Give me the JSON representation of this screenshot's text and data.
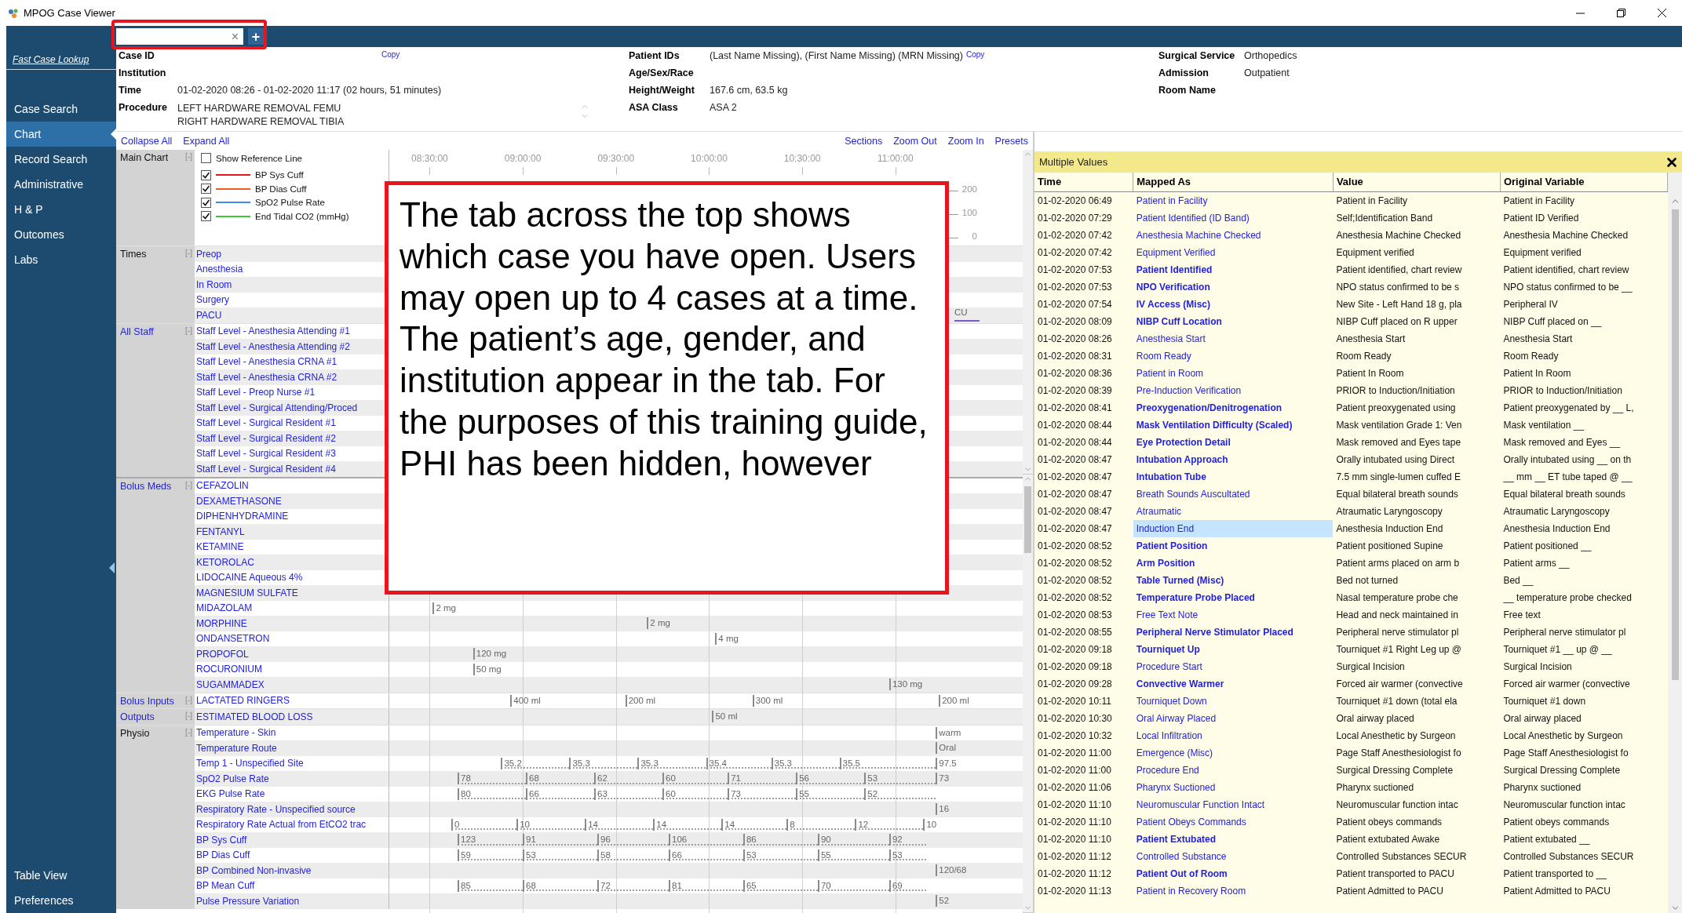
{
  "window": {
    "title": "MPOG Case Viewer"
  },
  "tab_bar": {
    "close_glyph": "×",
    "add_glyph": "+"
  },
  "sidebar": {
    "lookup": "Fast Case Lookup",
    "items": [
      {
        "label": "Case Search",
        "selected": false
      },
      {
        "label": "Chart",
        "selected": true
      },
      {
        "label": "Record Search",
        "selected": false
      },
      {
        "label": "Administrative",
        "selected": false
      },
      {
        "label": "H & P",
        "selected": false
      },
      {
        "label": "Outcomes",
        "selected": false
      },
      {
        "label": "Labs",
        "selected": false
      }
    ],
    "bottom_items": [
      {
        "label": "Table View",
        "selected": false
      },
      {
        "label": "Preferences",
        "selected": false
      }
    ]
  },
  "case_header": {
    "columns": [
      [
        {
          "label": "Case ID",
          "copy": "Copy"
        },
        {
          "label": "Institution"
        },
        {
          "label": "Time",
          "value": "01-02-2020 08:26 - 01-02-2020 11:17 (02 hours, 51 minutes)"
        },
        {
          "label": "Procedure",
          "lines": [
            "LEFT HARDWARE REMOVAL FEMU",
            "RIGHT HARDWARE REMOVAL TIBIA"
          ]
        }
      ],
      [
        {
          "label": "Patient IDs",
          "value": "(Last Name Missing), (First Name Missing) (MRN Missing)",
          "copy": "Copy"
        },
        {
          "label": "Age/Sex/Race"
        },
        {
          "label": "Height/Weight",
          "value": "167.6 cm, 63.5 kg"
        },
        {
          "label": "ASA Class",
          "value": "ASA 2"
        }
      ],
      [
        {
          "label": "Surgical Service",
          "value": "Orthopedics"
        },
        {
          "label": "Admission",
          "value": "Outpatient"
        },
        {
          "label": "Room Name"
        }
      ]
    ]
  },
  "chart": {
    "links_left": [
      "Collapse All",
      "Expand All"
    ],
    "links_right": [
      "Sections",
      "Zoom Out",
      "Zoom In",
      "Presets"
    ],
    "axis": [
      "08:30:00",
      "09:00:00",
      "09:30:00",
      "10:00:00",
      "10:30:00",
      "11:00:00"
    ],
    "main_chart": {
      "label": "Main Chart",
      "toggle": "[-]",
      "reference": {
        "label": "Show Reference Line",
        "checked": false
      },
      "series": [
        {
          "name": "BP Sys Cuff",
          "checked": true,
          "color": "#e8141e"
        },
        {
          "name": "BP Dias Cuff",
          "checked": true,
          "color": "#f05a1e"
        },
        {
          "name": "SpO2 Pulse Rate",
          "checked": true,
          "color": "#3c8cf0"
        },
        {
          "name": "End Tidal CO2 (mmHg)",
          "checked": true,
          "color": "#3cc83c"
        }
      ],
      "scale": [
        "200",
        "100",
        "0"
      ]
    },
    "groups": [
      {
        "label": "Times",
        "link": false,
        "toggle": "[-]",
        "rows": [
          {
            "label": "Preop"
          },
          {
            "label": "Anesthesia"
          },
          {
            "label": "In Room"
          },
          {
            "label": "Surgery"
          },
          {
            "label": "PACU",
            "markers": [
              {
                "kind": "span",
                "text": "CU"
              }
            ]
          }
        ]
      },
      {
        "label": "All Staff",
        "link": true,
        "toggle": "[-]",
        "rows": [
          {
            "label": "Staff Level - Anesthesia Attending #1"
          },
          {
            "label": "Staff Level - Anesthesia Attending #2"
          },
          {
            "label": "Staff Level - Anesthesia CRNA #1"
          },
          {
            "label": "Staff Level - Anesthesia CRNA #2"
          },
          {
            "label": "Staff Level - Preop Nurse #1"
          },
          {
            "label": "Staff Level - Surgical Attending/Proced"
          },
          {
            "label": "Staff Level - Surgical Resident #1"
          },
          {
            "label": "Staff Level - Surgical Resident #2"
          },
          {
            "label": "Staff Level - Surgical Resident #3"
          },
          {
            "label": "Staff Level - Surgical Resident #4"
          }
        ]
      },
      {
        "label": "Bolus Meds",
        "link": true,
        "toggle": "[-]",
        "rows": [
          {
            "label": "CEFAZOLIN"
          },
          {
            "label": "DEXAMETHASONE"
          },
          {
            "label": "DIPHENHYDRAMINE"
          },
          {
            "label": "FENTANYL"
          },
          {
            "label": "KETAMINE"
          },
          {
            "label": "KETOROLAC"
          },
          {
            "label": "LIDOCAINE Aqueous 4%"
          },
          {
            "label": "MAGNESIUM SULFATE"
          },
          {
            "label": "MIDAZOLAM",
            "markers": [
              {
                "kind": "tick",
                "text": "2 mg",
                "dotted": false
              }
            ]
          },
          {
            "label": "MORPHINE",
            "markers": [
              {
                "kind": "tick",
                "text": "2 mg",
                "dotted": false
              }
            ]
          },
          {
            "label": "ONDANSETRON",
            "markers": [
              {
                "kind": "tick",
                "text": "4 mg",
                "dotted": false
              }
            ]
          },
          {
            "label": "PROPOFOL",
            "markers": [
              {
                "kind": "tick",
                "text": "120 mg",
                "dotted": false
              }
            ]
          },
          {
            "label": "ROCURONIUM",
            "markers": [
              {
                "kind": "tick",
                "text": "50 mg",
                "dotted": false
              }
            ]
          },
          {
            "label": "SUGAMMADEX",
            "markers": [
              {
                "kind": "tick",
                "text": "130 mg",
                "dotted": false
              }
            ]
          }
        ]
      },
      {
        "label": "Bolus Inputs",
        "link": true,
        "toggle": "[-]",
        "rows": [
          {
            "label": "LACTATED RINGERS",
            "markers": [
              {
                "kind": "tick",
                "text": "400 ml",
                "dotted": false
              },
              {
                "kind": "tick",
                "text": "200 ml",
                "dotted": false
              },
              {
                "kind": "tick",
                "text": "300 ml",
                "dotted": false
              },
              {
                "kind": "tick",
                "text": "200 ml",
                "dotted": false
              }
            ]
          }
        ]
      },
      {
        "label": "Outputs",
        "link": true,
        "toggle": "[-]",
        "rows": [
          {
            "label": "ESTIMATED BLOOD LOSS",
            "markers": [
              {
                "kind": "tick",
                "text": "50 ml",
                "dotted": false
              }
            ]
          }
        ]
      },
      {
        "label": "Physio",
        "link": false,
        "toggle": "[-]",
        "rows": [
          {
            "label": "Temperature - Skin",
            "markers": [
              {
                "kind": "tick",
                "text": "warm",
                "dotted": false
              }
            ]
          },
          {
            "label": "Temperature Route",
            "markers": [
              {
                "kind": "tick",
                "text": "Oral",
                "dotted": false
              }
            ]
          },
          {
            "label": "Temp 1 - Unspecified Site",
            "markers": [
              {
                "kind": "tick",
                "text": "35.2",
                "dotted": true
              },
              {
                "kind": "tick",
                "text": "35.3",
                "dotted": true
              },
              {
                "kind": "tick",
                "text": "35.3",
                "dotted": true
              },
              {
                "kind": "tick",
                "text": "35.4",
                "dotted": true
              },
              {
                "kind": "tick",
                "text": "35.3",
                "dotted": true
              },
              {
                "kind": "tick",
                "text": "35.5",
                "dotted": true
              },
              {
                "kind": "tick",
                "text": "97.5",
                "dotted": false
              }
            ]
          },
          {
            "label": "SpO2 Pulse Rate",
            "markers": [
              {
                "kind": "tick",
                "text": "78",
                "dotted": true
              },
              {
                "kind": "tick",
                "text": "68",
                "dotted": true
              },
              {
                "kind": "tick",
                "text": "62",
                "dotted": true
              },
              {
                "kind": "tick",
                "text": "60",
                "dotted": true
              },
              {
                "kind": "tick",
                "text": "71",
                "dotted": true
              },
              {
                "kind": "tick",
                "text": "56",
                "dotted": true
              },
              {
                "kind": "tick",
                "text": "53",
                "dotted": true
              },
              {
                "kind": "tick",
                "text": "73",
                "dotted": false
              }
            ]
          },
          {
            "label": "EKG Pulse Rate",
            "markers": [
              {
                "kind": "tick",
                "text": "80",
                "dotted": true
              },
              {
                "kind": "tick",
                "text": "66",
                "dotted": true
              },
              {
                "kind": "tick",
                "text": "63",
                "dotted": true
              },
              {
                "kind": "tick",
                "text": "60",
                "dotted": true
              },
              {
                "kind": "tick",
                "text": "73",
                "dotted": true
              },
              {
                "kind": "tick",
                "text": "55",
                "dotted": true
              },
              {
                "kind": "tick",
                "text": "52",
                "dotted": true
              }
            ]
          },
          {
            "label": "Respiratory Rate - Unspecified source",
            "markers": [
              {
                "kind": "tick",
                "text": "16",
                "dotted": false
              }
            ]
          },
          {
            "label": "Respiratory Rate Actual from EtCO2 trac",
            "markers": [
              {
                "kind": "tick",
                "text": "0",
                "dotted": true
              },
              {
                "kind": "tick",
                "text": "10",
                "dotted": true
              },
              {
                "kind": "tick",
                "text": "14",
                "dotted": true
              },
              {
                "kind": "tick",
                "text": "14",
                "dotted": true
              },
              {
                "kind": "tick",
                "text": "14",
                "dotted": true
              },
              {
                "kind": "tick",
                "text": "8",
                "dotted": true
              },
              {
                "kind": "tick",
                "text": "12",
                "dotted": true
              },
              {
                "kind": "tick",
                "text": "10",
                "dotted": false
              }
            ]
          },
          {
            "label": "BP Sys Cuff",
            "markers": [
              {
                "kind": "tick",
                "text": "123",
                "dotted": true
              },
              {
                "kind": "tick",
                "text": "91",
                "dotted": true
              },
              {
                "kind": "tick",
                "text": "96",
                "dotted": true
              },
              {
                "kind": "tick",
                "text": "106",
                "dotted": true
              },
              {
                "kind": "tick",
                "text": "86",
                "dotted": true
              },
              {
                "kind": "tick",
                "text": "90",
                "dotted": true
              },
              {
                "kind": "tick",
                "text": "92",
                "dotted": true
              }
            ]
          },
          {
            "label": "BP Dias Cuff",
            "markers": [
              {
                "kind": "tick",
                "text": "59",
                "dotted": true
              },
              {
                "kind": "tick",
                "text": "53",
                "dotted": true
              },
              {
                "kind": "tick",
                "text": "58",
                "dotted": true
              },
              {
                "kind": "tick",
                "text": "66",
                "dotted": true
              },
              {
                "kind": "tick",
                "text": "53",
                "dotted": true
              },
              {
                "kind": "tick",
                "text": "55",
                "dotted": true
              },
              {
                "kind": "tick",
                "text": "53",
                "dotted": true
              }
            ]
          },
          {
            "label": "BP Combined Non-invasive",
            "markers": [
              {
                "kind": "tick",
                "text": "120/68",
                "dotted": false
              }
            ]
          },
          {
            "label": "BP Mean Cuff",
            "markers": [
              {
                "kind": "tick",
                "text": "85",
                "dotted": true
              },
              {
                "kind": "tick",
                "text": "68",
                "dotted": true
              },
              {
                "kind": "tick",
                "text": "72",
                "dotted": true
              },
              {
                "kind": "tick",
                "text": "81",
                "dotted": true
              },
              {
                "kind": "tick",
                "text": "65",
                "dotted": true
              },
              {
                "kind": "tick",
                "text": "70",
                "dotted": true
              },
              {
                "kind": "tick",
                "text": "69",
                "dotted": true
              }
            ]
          },
          {
            "label": "Pulse Pressure Variation",
            "markers": [
              {
                "kind": "tick",
                "text": "52",
                "dotted": false
              }
            ]
          }
        ]
      }
    ]
  },
  "callout": {
    "text": "The tab across the top shows which case you have open. Users may open up to 4 cases at a time. The patient’s age, gender, and institution appear in the tab. For the purposes of this training guide, PHI has been hidden, however"
  },
  "values_panel": {
    "title": "Multiple Values",
    "columns": [
      "Time",
      "Mapped As",
      "Value",
      "Original Variable"
    ],
    "rows": [
      {
        "time": "01-02-2020 06:49",
        "mapped": "Patient in Facility",
        "emphasized": false,
        "selected": false,
        "value": "Patient in Facility",
        "original": "Patient in Facility"
      },
      {
        "time": "01-02-2020 07:29",
        "mapped": "Patient Identified (ID Band)",
        "emphasized": false,
        "selected": false,
        "value": "Self;Identification Band",
        "original": "Patient ID Verified"
      },
      {
        "time": "01-02-2020 07:42",
        "mapped": "Anesthesia Machine Checked",
        "emphasized": false,
        "selected": false,
        "value": "Anesthesia Machine Checked",
        "original": "Anesthesia Machine Checked"
      },
      {
        "time": "01-02-2020 07:42",
        "mapped": "Equipment Verified",
        "emphasized": false,
        "selected": false,
        "value": "Equipment verified",
        "original": "Equipment verified"
      },
      {
        "time": "01-02-2020 07:53",
        "mapped": "Patient Identified",
        "emphasized": true,
        "selected": false,
        "value": "Patient identified, chart review",
        "original": "Patient identified, chart review"
      },
      {
        "time": "01-02-2020 07:53",
        "mapped": "NPO Verification",
        "emphasized": true,
        "selected": false,
        "value": "NPO status confirmed to be s",
        "original": "NPO status confirmed to be __"
      },
      {
        "time": "01-02-2020 07:54",
        "mapped": "IV Access (Misc)",
        "emphasized": true,
        "selected": false,
        "value": "New Site - Left Hand 18 g, pla",
        "original": "Peripheral IV"
      },
      {
        "time": "01-02-2020 08:09",
        "mapped": "NIBP Cuff Location",
        "emphasized": true,
        "selected": false,
        "value": "NIBP Cuff placed on R upper",
        "original": "NIBP Cuff placed on __"
      },
      {
        "time": "01-02-2020 08:26",
        "mapped": "Anesthesia Start",
        "emphasized": false,
        "selected": false,
        "value": "Anesthesia Start",
        "original": "Anesthesia Start"
      },
      {
        "time": "01-02-2020 08:31",
        "mapped": "Room Ready",
        "emphasized": false,
        "selected": false,
        "value": "Room Ready",
        "original": "Room Ready"
      },
      {
        "time": "01-02-2020 08:36",
        "mapped": "Patient in Room",
        "emphasized": false,
        "selected": false,
        "value": "Patient In Room",
        "original": "Patient In Room"
      },
      {
        "time": "01-02-2020 08:39",
        "mapped": "Pre-Induction Verification",
        "emphasized": false,
        "selected": false,
        "value": "PRIOR to Induction/Initiation",
        "original": "PRIOR to Induction/Initiation"
      },
      {
        "time": "01-02-2020 08:41",
        "mapped": "Preoxygenation/Denitrogenation",
        "emphasized": true,
        "selected": false,
        "value": "Patient preoxygenated using",
        "original": "Patient preoxygenated by __ L,"
      },
      {
        "time": "01-02-2020 08:44",
        "mapped": "Mask Ventilation Difficulty (Scaled)",
        "emphasized": true,
        "selected": false,
        "value": "Mask ventilation Grade 1: Ven",
        "original": "Mask ventilation __"
      },
      {
        "time": "01-02-2020 08:44",
        "mapped": "Eye Protection Detail",
        "emphasized": true,
        "selected": false,
        "value": "Mask removed and Eyes tape",
        "original": "Mask removed and Eyes __"
      },
      {
        "time": "01-02-2020 08:47",
        "mapped": "Intubation Approach",
        "emphasized": true,
        "selected": false,
        "value": "Orally intubated using Direct",
        "original": "Orally intubated using __ on th"
      },
      {
        "time": "01-02-2020 08:47",
        "mapped": "Intubation Tube",
        "emphasized": true,
        "selected": false,
        "value": "7.5 mm single-lumen cuffed E",
        "original": "__ mm __ ET tube taped @ __"
      },
      {
        "time": "01-02-2020 08:47",
        "mapped": "Breath Sounds Auscultated",
        "emphasized": false,
        "selected": false,
        "value": "Equal bilateral breath sounds",
        "original": "Equal bilateral breath sounds"
      },
      {
        "time": "01-02-2020 08:47",
        "mapped": "Atraumatic",
        "emphasized": false,
        "selected": false,
        "value": "Atraumatic Laryngoscopy",
        "original": "Atraumatic Laryngoscopy"
      },
      {
        "time": "01-02-2020 08:47",
        "mapped": "Induction End",
        "emphasized": false,
        "selected": true,
        "value": "Anesthesia Induction End",
        "original": "Anesthesia Induction End"
      },
      {
        "time": "01-02-2020 08:52",
        "mapped": "Patient Position",
        "emphasized": true,
        "selected": false,
        "value": "Patient positioned Supine",
        "original": "Patient positioned __"
      },
      {
        "time": "01-02-2020 08:52",
        "mapped": "Arm Position",
        "emphasized": true,
        "selected": false,
        "value": "Patient arms placed on arm b",
        "original": "Patient arms __"
      },
      {
        "time": "01-02-2020 08:52",
        "mapped": "Table Turned (Misc)",
        "emphasized": true,
        "selected": false,
        "value": "Bed not turned",
        "original": "Bed __"
      },
      {
        "time": "01-02-2020 08:52",
        "mapped": "Temperature Probe Placed",
        "emphasized": true,
        "selected": false,
        "value": "Nasal temperature probe che",
        "original": "__ temperature probe checked"
      },
      {
        "time": "01-02-2020 08:53",
        "mapped": "Free Text Note",
        "emphasized": false,
        "selected": false,
        "value": "Head and neck maintained in",
        "original": "Free text"
      },
      {
        "time": "01-02-2020 08:55",
        "mapped": "Peripheral Nerve Stimulator Placed",
        "emphasized": true,
        "selected": false,
        "value": "Peripheral nerve stimulator pl",
        "original": "Peripheral nerve stimulator pl"
      },
      {
        "time": "01-02-2020 09:18",
        "mapped": "Tourniquet Up",
        "emphasized": true,
        "selected": false,
        "value": "Tourniquet #1 Right Leg up @",
        "original": "Tourniquet #1 __ up @ __"
      },
      {
        "time": "01-02-2020 09:18",
        "mapped": "Procedure Start",
        "emphasized": false,
        "selected": false,
        "value": "Surgical Incision",
        "original": "Surgical Incision"
      },
      {
        "time": "01-02-2020 09:28",
        "mapped": "Convective Warmer",
        "emphasized": true,
        "selected": false,
        "value": "Forced air warmer (convective",
        "original": "Forced air warmer (convective"
      },
      {
        "time": "01-02-2020 10:11",
        "mapped": "Tourniquet Down",
        "emphasized": false,
        "selected": false,
        "value": "Tourniquet #1 down (total ela",
        "original": "Tourniquet #1 down"
      },
      {
        "time": "01-02-2020 10:30",
        "mapped": "Oral Airway Placed",
        "emphasized": false,
        "selected": false,
        "value": "Oral airway placed",
        "original": "Oral airway placed"
      },
      {
        "time": "01-02-2020 10:32",
        "mapped": "Local Infiltration",
        "emphasized": false,
        "selected": false,
        "value": "Local Anesthetic by Surgeon",
        "original": "Local Anesthetic by Surgeon"
      },
      {
        "time": "01-02-2020 11:00",
        "mapped": "Emergence (Misc)",
        "emphasized": false,
        "selected": false,
        "value": "Page Staff Anesthesiologist fo",
        "original": "Page Staff Anesthesiologist fo"
      },
      {
        "time": "01-02-2020 11:00",
        "mapped": "Procedure End",
        "emphasized": false,
        "selected": false,
        "value": "Surgical Dressing Complete",
        "original": "Surgical Dressing Complete"
      },
      {
        "time": "01-02-2020 11:06",
        "mapped": "Pharynx Suctioned",
        "emphasized": false,
        "selected": false,
        "value": "Pharynx suctioned",
        "original": "Pharynx suctioned"
      },
      {
        "time": "01-02-2020 11:10",
        "mapped": "Neuromuscular Function Intact",
        "emphasized": false,
        "selected": false,
        "value": "Neuromuscular function intac",
        "original": "Neuromuscular function intac"
      },
      {
        "time": "01-02-2020 11:10",
        "mapped": "Patient Obeys Commands",
        "emphasized": false,
        "selected": false,
        "value": "Patient obeys commands",
        "original": "Patient obeys commands"
      },
      {
        "time": "01-02-2020 11:10",
        "mapped": "Patient Extubated",
        "emphasized": true,
        "selected": false,
        "value": "Patient extubated Awake",
        "original": "Patient extubated __"
      },
      {
        "time": "01-02-2020 11:12",
        "mapped": "Controlled Substance",
        "emphasized": false,
        "selected": false,
        "value": "Controlled Substances SECUR",
        "original": "Controlled Substances SECUR"
      },
      {
        "time": "01-02-2020 11:12",
        "mapped": "Patient Out of Room",
        "emphasized": true,
        "selected": false,
        "value": "Patient transported to PACU",
        "original": "Patient transported to __"
      },
      {
        "time": "01-02-2020 11:13",
        "mapped": "Patient in Recovery Room",
        "emphasized": false,
        "selected": false,
        "value": "Patient Admitted to PACU",
        "original": "Patient Admitted to PACU"
      }
    ]
  }
}
